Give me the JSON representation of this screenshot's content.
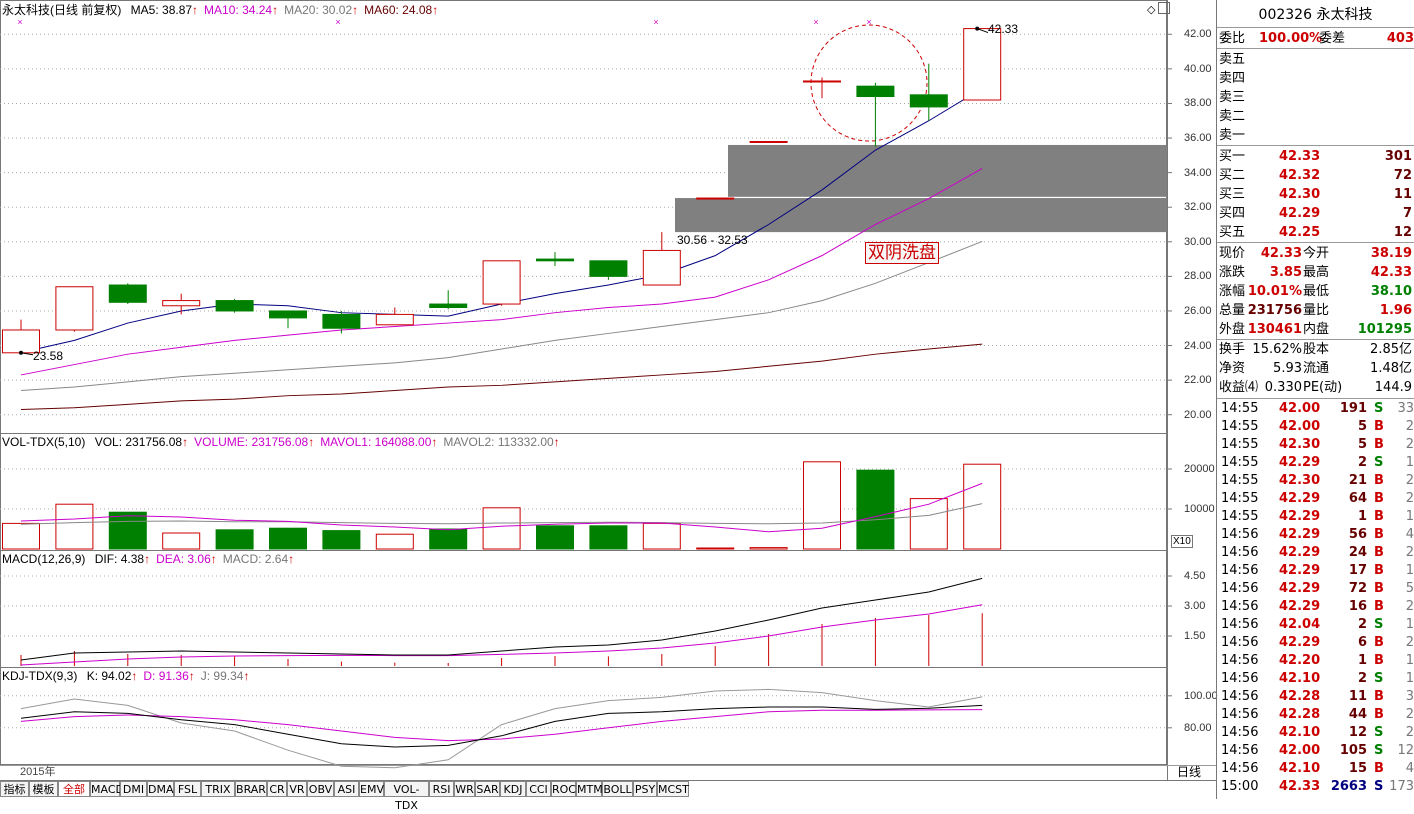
{
  "colors": {
    "up": "#cc0000",
    "down": "#008000",
    "ma5": "#000080",
    "ma10": "#cc00cc",
    "ma20": "#888888",
    "ma60": "#660000",
    "grid": "#999999"
  },
  "main_panel": {
    "title": "永太科技(日线 前复权)",
    "legend": [
      {
        "label": "MA5: 38.87",
        "color": "#000000"
      },
      {
        "label": "MA10: 34.24",
        "color": "#cc00cc"
      },
      {
        "label": "MA20: 30.02",
        "color": "#777777"
      },
      {
        "label": "MA60: 24.08",
        "color": "#660000"
      }
    ],
    "y_ticks": [
      "42.00",
      "40.00",
      "38.00",
      "36.00",
      "34.00",
      "32.00",
      "30.00",
      "28.00",
      "26.00",
      "24.00",
      "22.00",
      "20.00"
    ],
    "low_marker": "23.58",
    "high_marker": "42.33",
    "range_label": "30.56 - 32.53",
    "annotation": "双阴洗盘"
  },
  "vol_panel": {
    "title": "VOL-TDX(5,10)",
    "legend": [
      {
        "label": "VOL: 231756.08",
        "color": "#000000"
      },
      {
        "label": "VOLUME: 231756.08",
        "color": "#cc00cc"
      },
      {
        "label": "MAVOL1: 164088.00",
        "color": "#cc00cc"
      },
      {
        "label": "MAVOL2: 113332.00",
        "color": "#777777"
      }
    ],
    "y_ticks": [
      "20000",
      "10000"
    ],
    "unit": "X10"
  },
  "macd_panel": {
    "title": "MACD(12,26,9)",
    "legend": [
      {
        "label": "DIF: 4.38",
        "color": "#000000"
      },
      {
        "label": "DEA: 3.06",
        "color": "#cc00cc"
      },
      {
        "label": "MACD: 2.64",
        "color": "#777777"
      }
    ],
    "y_ticks": [
      "4.50",
      "3.00",
      "1.50"
    ]
  },
  "kdj_panel": {
    "title": "KDJ-TDX(9,3)",
    "legend": [
      {
        "label": "K: 94.02",
        "color": "#000000"
      },
      {
        "label": "D: 91.36",
        "color": "#cc00cc"
      },
      {
        "label": "J: 99.34",
        "color": "#777777"
      }
    ],
    "y_ticks": [
      "100.00",
      "80.00"
    ]
  },
  "footer": {
    "year": "2015年",
    "period": "日线"
  },
  "bottom_tabs": [
    "指标",
    "模板",
    "全部",
    "MACD",
    "DMI",
    "DMA",
    "FSL",
    "TRIX",
    "BRAR",
    "CR",
    "VR",
    "OBV",
    "ASI",
    "EMV",
    "VOL-TDX",
    "RSI",
    "WR",
    "SAR",
    "KDJ",
    "CCI",
    "ROC",
    "MTM",
    "BOLL",
    "PSY",
    "MCST"
  ],
  "chart_data": [
    {
      "type": "candlestick",
      "title": "永太科技(日线 前复权)",
      "ylim": [
        19,
        43
      ],
      "candles": [
        {
          "o": 23.58,
          "c": 24.9,
          "h": 25.5,
          "l": 23.5
        },
        {
          "o": 24.9,
          "c": 27.4,
          "h": 27.4,
          "l": 24.8
        },
        {
          "o": 27.5,
          "c": 26.5,
          "h": 27.6,
          "l": 26.4
        },
        {
          "o": 26.3,
          "c": 26.6,
          "h": 27.0,
          "l": 25.8
        },
        {
          "o": 26.6,
          "c": 26.0,
          "h": 26.7,
          "l": 25.9
        },
        {
          "o": 26.0,
          "c": 25.6,
          "h": 26.0,
          "l": 25.0
        },
        {
          "o": 25.8,
          "c": 25.0,
          "h": 26.0,
          "l": 24.7
        },
        {
          "o": 25.2,
          "c": 25.8,
          "h": 26.2,
          "l": 25.2
        },
        {
          "o": 26.4,
          "c": 26.2,
          "h": 27.2,
          "l": 26.1
        },
        {
          "o": 26.4,
          "c": 28.9,
          "h": 28.9,
          "l": 26.3
        },
        {
          "o": 29.0,
          "c": 28.9,
          "h": 29.4,
          "l": 28.6
        },
        {
          "o": 28.9,
          "c": 28.0,
          "h": 28.9,
          "l": 27.8
        },
        {
          "o": 27.5,
          "c": 29.5,
          "h": 30.56,
          "l": 27.5
        },
        {
          "o": 32.53,
          "c": 32.53,
          "h": 32.53,
          "l": 32.53
        },
        {
          "o": 35.8,
          "c": 35.8,
          "h": 35.8,
          "l": 35.8
        },
        {
          "o": 39.3,
          "c": 39.3,
          "h": 39.5,
          "l": 38.3
        },
        {
          "o": 39.0,
          "c": 38.4,
          "h": 39.2,
          "l": 35.5
        },
        {
          "o": 38.5,
          "c": 37.8,
          "h": 40.3,
          "l": 37.0
        },
        {
          "o": 38.2,
          "c": 42.33,
          "h": 42.33,
          "l": 38.2
        }
      ],
      "ma5": [
        23.6,
        24.3,
        25.3,
        26.0,
        26.4,
        26.3,
        25.9,
        25.8,
        25.7,
        26.4,
        27.0,
        27.5,
        28.1,
        29.2,
        31.0,
        33.0,
        35.3,
        37.0,
        38.87
      ],
      "ma10": [
        22.3,
        22.9,
        23.5,
        23.9,
        24.3,
        24.6,
        24.9,
        25.1,
        25.3,
        25.5,
        25.9,
        26.2,
        26.4,
        26.8,
        27.8,
        29.2,
        31.0,
        32.5,
        34.24
      ],
      "ma20": [
        21.4,
        21.6,
        21.9,
        22.2,
        22.4,
        22.6,
        22.8,
        23.0,
        23.3,
        23.8,
        24.3,
        24.7,
        25.1,
        25.5,
        25.9,
        26.6,
        27.6,
        28.8,
        30.02
      ],
      "ma60": [
        20.3,
        20.4,
        20.6,
        20.8,
        20.9,
        21.1,
        21.2,
        21.4,
        21.6,
        21.7,
        21.9,
        22.1,
        22.3,
        22.5,
        22.8,
        23.1,
        23.5,
        23.8,
        24.08
      ]
    },
    {
      "type": "bar",
      "title": "VOL-TDX(5,10)",
      "ylim": [
        0,
        25000
      ],
      "values": [
        6400,
        11200,
        9200,
        4000,
        4800,
        5200,
        4600,
        3700,
        5000,
        10300,
        5800,
        5800,
        6400,
        250,
        350,
        21800,
        19700,
        12600,
        21200
      ],
      "colors": [
        "up",
        "up",
        "down",
        "up",
        "down",
        "down",
        "down",
        "up",
        "down",
        "up",
        "down",
        "down",
        "up",
        "up",
        "up",
        "up",
        "down",
        "up",
        "up"
      ],
      "mavol1": [
        7000,
        7500,
        8300,
        8000,
        7200,
        6900,
        6000,
        5500,
        4800,
        5700,
        6200,
        6500,
        6500,
        5500,
        4300,
        5200,
        8100,
        11200,
        16408.8
      ],
      "mavol2": [
        6200,
        6600,
        6900,
        7000,
        6800,
        6800,
        6600,
        6400,
        6300,
        6500,
        6600,
        6700,
        6600,
        6400,
        6300,
        6500,
        7300,
        8400,
        11333.2
      ]
    },
    {
      "type": "bar",
      "title": "MACD(12,26,9)",
      "ylim": [
        0,
        5
      ],
      "macd": [
        0.55,
        0.75,
        0.6,
        0.55,
        0.5,
        0.35,
        0.22,
        0.17,
        0.15,
        0.4,
        0.5,
        0.48,
        0.6,
        1.0,
        1.6,
        2.1,
        2.4,
        2.55,
        2.64
      ],
      "dif": [
        0.3,
        0.65,
        0.7,
        0.75,
        0.7,
        0.65,
        0.6,
        0.55,
        0.55,
        0.75,
        0.95,
        1.05,
        1.3,
        1.75,
        2.3,
        2.9,
        3.3,
        3.7,
        4.38
      ],
      "dea": [
        0.05,
        0.2,
        0.35,
        0.45,
        0.5,
        0.52,
        0.53,
        0.52,
        0.52,
        0.58,
        0.65,
        0.75,
        0.9,
        1.15,
        1.5,
        1.95,
        2.3,
        2.6,
        3.06
      ]
    },
    {
      "type": "line",
      "title": "KDJ-TDX(9,3)",
      "ylim": [
        58,
        108
      ],
      "k": [
        86,
        90,
        89,
        85,
        82,
        76,
        70,
        68,
        69,
        75,
        84,
        89,
        90,
        92,
        93,
        93,
        91.5,
        92.2,
        94.02
      ],
      "d": [
        84,
        87,
        88,
        87,
        85,
        82,
        78,
        74,
        72,
        73,
        76,
        80,
        84,
        87,
        90,
        91,
        91,
        91.2,
        91.36
      ],
      "j": [
        92,
        98,
        94,
        83,
        78,
        66,
        56,
        55,
        60,
        82,
        92,
        97,
        99,
        103,
        104,
        102,
        97,
        93,
        99.34
      ]
    }
  ],
  "quote": {
    "code": "002326",
    "name": "永太科技",
    "weibi_label": "委比",
    "weibi": "100.00%",
    "weicha_label": "委差",
    "weicha": "403",
    "asks": [
      {
        "label": "卖五"
      },
      {
        "label": "卖四"
      },
      {
        "label": "卖三"
      },
      {
        "label": "卖二"
      },
      {
        "label": "卖一"
      }
    ],
    "bids": [
      {
        "label": "买一",
        "price": "42.33",
        "vol": "301"
      },
      {
        "label": "买二",
        "price": "42.32",
        "vol": "72"
      },
      {
        "label": "买三",
        "price": "42.30",
        "vol": "11"
      },
      {
        "label": "买四",
        "price": "42.29",
        "vol": "7"
      },
      {
        "label": "买五",
        "price": "42.25",
        "vol": "12"
      }
    ],
    "stats1": [
      {
        "l1": "现价",
        "v1": "42.33",
        "l2": "今开",
        "v2": "38.19",
        "c1": "up",
        "c2": "up"
      },
      {
        "l1": "涨跌",
        "v1": "3.85",
        "l2": "最高",
        "v2": "42.33",
        "c1": "up",
        "c2": "up"
      },
      {
        "l1": "涨幅",
        "v1": "10.01%",
        "l2": "最低",
        "v2": "38.10",
        "c1": "up",
        "c2": "dn"
      },
      {
        "l1": "总量",
        "v1": "231756",
        "l2": "量比",
        "v2": "1.96",
        "c1": "drk",
        "c2": "up"
      },
      {
        "l1": "外盘",
        "v1": "130461",
        "l2": "内盘",
        "v2": "101295",
        "c1": "up",
        "c2": "dn"
      }
    ],
    "stats2": [
      {
        "l1": "换手",
        "v1": "15.62%",
        "l2": "股本",
        "v2": "2.85亿"
      },
      {
        "l1": "净资",
        "v1": "5.93",
        "l2": "流通",
        "v2": "1.48亿"
      },
      {
        "l1": "收益⑷",
        "v1": "0.330",
        "l2": "PE(动)",
        "v2": "144.9"
      }
    ],
    "ticks": [
      {
        "t": "14:55",
        "p": "42.00",
        "v": "191",
        "s": "S",
        "n": "33",
        "pc": "up",
        "sc": "dn"
      },
      {
        "t": "14:55",
        "p": "42.00",
        "v": "5",
        "s": "B",
        "n": "2",
        "pc": "up",
        "sc": "up"
      },
      {
        "t": "14:55",
        "p": "42.30",
        "v": "5",
        "s": "B",
        "n": "2",
        "pc": "up",
        "sc": "up"
      },
      {
        "t": "14:55",
        "p": "42.29",
        "v": "2",
        "s": "S",
        "n": "1",
        "pc": "up",
        "sc": "dn"
      },
      {
        "t": "14:55",
        "p": "42.30",
        "v": "21",
        "s": "B",
        "n": "2",
        "pc": "up",
        "sc": "up"
      },
      {
        "t": "14:55",
        "p": "42.29",
        "v": "64",
        "s": "B",
        "n": "2",
        "pc": "up",
        "sc": "up"
      },
      {
        "t": "14:55",
        "p": "42.29",
        "v": "1",
        "s": "B",
        "n": "1",
        "pc": "up",
        "sc": "up"
      },
      {
        "t": "14:56",
        "p": "42.29",
        "v": "56",
        "s": "B",
        "n": "4",
        "pc": "up",
        "sc": "up"
      },
      {
        "t": "14:56",
        "p": "42.29",
        "v": "24",
        "s": "B",
        "n": "2",
        "pc": "up",
        "sc": "up"
      },
      {
        "t": "14:56",
        "p": "42.29",
        "v": "17",
        "s": "B",
        "n": "1",
        "pc": "up",
        "sc": "up"
      },
      {
        "t": "14:56",
        "p": "42.29",
        "v": "72",
        "s": "B",
        "n": "5",
        "pc": "up",
        "sc": "up"
      },
      {
        "t": "14:56",
        "p": "42.29",
        "v": "16",
        "s": "B",
        "n": "2",
        "pc": "up",
        "sc": "up"
      },
      {
        "t": "14:56",
        "p": "42.04",
        "v": "2",
        "s": "S",
        "n": "1",
        "pc": "up",
        "sc": "dn"
      },
      {
        "t": "14:56",
        "p": "42.29",
        "v": "6",
        "s": "B",
        "n": "2",
        "pc": "up",
        "sc": "up"
      },
      {
        "t": "14:56",
        "p": "42.20",
        "v": "1",
        "s": "B",
        "n": "1",
        "pc": "up",
        "sc": "up"
      },
      {
        "t": "14:56",
        "p": "42.10",
        "v": "2",
        "s": "S",
        "n": "1",
        "pc": "up",
        "sc": "dn"
      },
      {
        "t": "14:56",
        "p": "42.28",
        "v": "11",
        "s": "B",
        "n": "3",
        "pc": "up",
        "sc": "up"
      },
      {
        "t": "14:56",
        "p": "42.28",
        "v": "44",
        "s": "B",
        "n": "2",
        "pc": "up",
        "sc": "up"
      },
      {
        "t": "14:56",
        "p": "42.10",
        "v": "12",
        "s": "S",
        "n": "2",
        "pc": "up",
        "sc": "dn"
      },
      {
        "t": "14:56",
        "p": "42.00",
        "v": "105",
        "s": "S",
        "n": "12",
        "pc": "up",
        "sc": "dn"
      },
      {
        "t": "14:56",
        "p": "42.10",
        "v": "15",
        "s": "B",
        "n": "4",
        "pc": "up",
        "sc": "up"
      },
      {
        "t": "15:00",
        "p": "42.33",
        "v": "2663",
        "s": "S",
        "n": "173",
        "pc": "up",
        "sc": "navy"
      }
    ]
  }
}
